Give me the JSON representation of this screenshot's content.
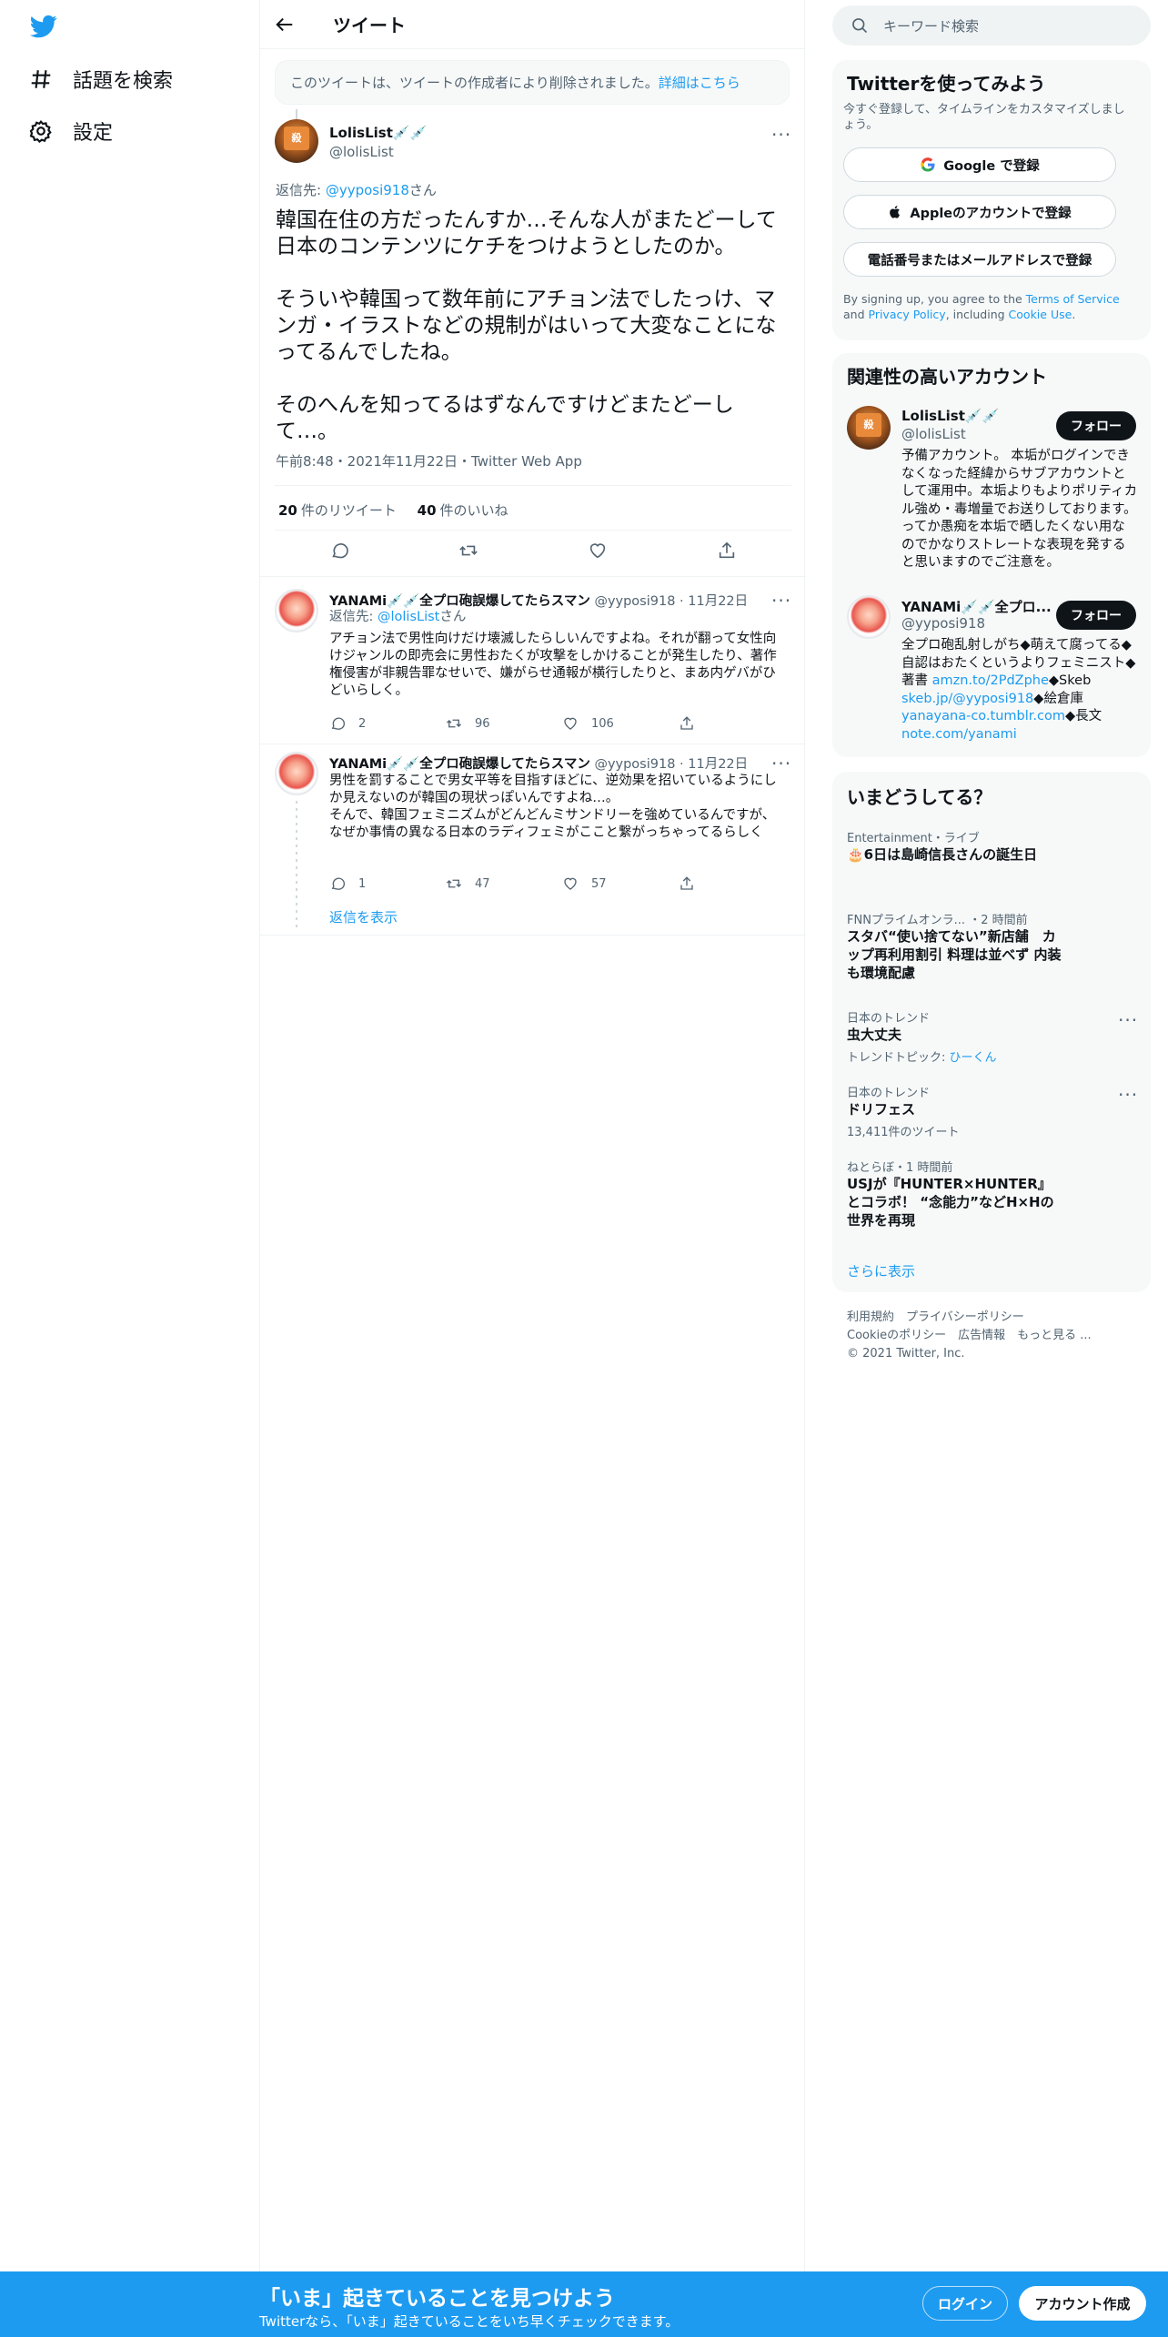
{
  "nav": {
    "explore_label": "話題を検索",
    "settings_label": "設定"
  },
  "header": {
    "title": "ツイート"
  },
  "notice": {
    "text": "このツイートは、ツイートの作成者により削除されました。",
    "link": "詳細はこちら"
  },
  "main_tweet": {
    "name": "LolisList💉💉",
    "handle": "@lolisList",
    "reply_prefix": "返信先: ",
    "reply_to": "@yyposi918",
    "reply_suffix": "さん",
    "text": "韓国在住の方だったんすか…そんな人がまたどーして日本のコンテンツにケチをつけようとしたのか。\n\nそういや韓国って数年前にアチョン法でしたっけ、マンガ・イラストなどの規制がはいって大変なことになってるんでしたね。\n\nそのへんを知ってるはずなんですけどまたどーして…。",
    "meta": "午前8:48・2021年11月22日・Twitter Web App",
    "retweets_count": "20",
    "retweets_label": "件のリツイート",
    "likes_count": "40",
    "likes_label": "件のいいね"
  },
  "replies": [
    {
      "name": "YANAMi💉💉全プロ砲誤爆してたらスマン",
      "handle": "@yyposi918 · 11月22日",
      "reply_prefix": "返信先: ",
      "reply_to": "@lolisList",
      "reply_suffix": "さん",
      "text": "アチョン法で男性向けだけ壊滅したらしいんですよね。それが翻って女性向けジャンルの即売会に男性おたくが攻撃をしかけることが発生したり、著作権侵害が非親告罪なせいで、嫌がらせ通報が横行したりと、まあ内ゲバがひどいらしく。",
      "replies": "2",
      "retweets": "96",
      "likes": "106"
    },
    {
      "name": "YANAMi💉💉全プロ砲誤爆してたらスマン",
      "handle": "@yyposi918 · 11月22日",
      "text": "男性を罰することで男女平等を目指すほどに、逆効果を招いているようにしか見えないのが韓国の現状っぽいんですよね…。\nそんで、韓国フェミニズムがどんどんミサンドリーを強めているんですが、なぜか事情の異なる日本のラディフェミがここと繋がっちゃってるらしく",
      "replies": "1",
      "retweets": "47",
      "likes": "57"
    }
  ],
  "show_replies": "返信を表示",
  "search": {
    "placeholder": "キーワード検索"
  },
  "signup": {
    "title": "Twitterを使ってみよう",
    "subtitle": "今すぐ登録して、タイムラインをカスタマイズしましょう。",
    "google": "Google で登録",
    "apple": "Appleのアカウントで登録",
    "phone": "電話番号またはメールアドレスで登録",
    "terms_1": "By signing up, you agree to the ",
    "terms_tos": "Terms of Service",
    "terms_2": " and ",
    "terms_privacy": "Privacy Policy",
    "terms_3": ", including ",
    "terms_cookie": "Cookie Use",
    "terms_4": "."
  },
  "related": {
    "title": "関連性の高いアカウント",
    "follow_label": "フォロー",
    "accounts": [
      {
        "name": "LolisList💉💉",
        "handle": "@lolisList",
        "bio": "予備アカウント。 本垢がログインできなくなった経緯からサブアカウントとして運用中。本垢よりもよりポリティカル強め・毒増量でお送りしております。ってか愚痴を本垢で晒したくない用なのでかなりストレートな表現を発すると思いますのでご注意を。"
      },
      {
        "name": "YANAMi💉💉全プロ...",
        "handle": "@yyposi918",
        "bio_1": "全プロ砲乱射しがち◆萌えて腐ってる◆自認はおたくというよりフェミニスト◆著書 ",
        "bio_link1": "amzn.to/2PdZphe",
        "bio_2": "◆Skeb ",
        "bio_link2": "skeb.jp/@yyposi918",
        "bio_3": "◆絵倉庫",
        "bio_link3": "yanayana-co.tumblr.com",
        "bio_4": "◆長文 ",
        "bio_link4": "note.com/yanami"
      }
    ]
  },
  "trends": {
    "title": "いまどうしてる？",
    "items": [
      {
        "context": "Entertainment・ライブ",
        "title": "🎂6日は島崎信長さんの誕生日",
        "extra": ""
      },
      {
        "context": "FNNプライムオンラ... ・2 時間前",
        "title": "スタバ“使い捨てない”新店舗　カップ再利用割引 料理は並べず 内装も環境配慮",
        "extra": ""
      },
      {
        "context": "日本のトレンド",
        "title": "虫大丈夫",
        "extra": "トレンドトピック: ",
        "extra_link": "ひーくん"
      },
      {
        "context": "日本のトレンド",
        "title": "ドリフェス",
        "extra": "13,411件のツイート"
      },
      {
        "context": "ねとらぼ・1 時間前",
        "title": "USJが『HUNTER×HUNTER』とコラボ！ “念能力”などH×Hの世界を再現",
        "extra": ""
      }
    ],
    "show_more": "さらに表示"
  },
  "footer": {
    "line1": "利用規約　プライバシーポリシー",
    "line2": "Cookieのポリシー　広告情報　もっと見る ...",
    "line3": "© 2021 Twitter, Inc."
  },
  "banner": {
    "headline": "「いま」起きていることを見つけよう",
    "sub": "Twitterなら、「いま」起きていることをいち早くチェックできます。",
    "login": "ログイン",
    "signup": "アカウント作成"
  },
  "colors": {
    "accent": "#1d9bf0",
    "text": "#0f1419",
    "muted": "#536471"
  }
}
